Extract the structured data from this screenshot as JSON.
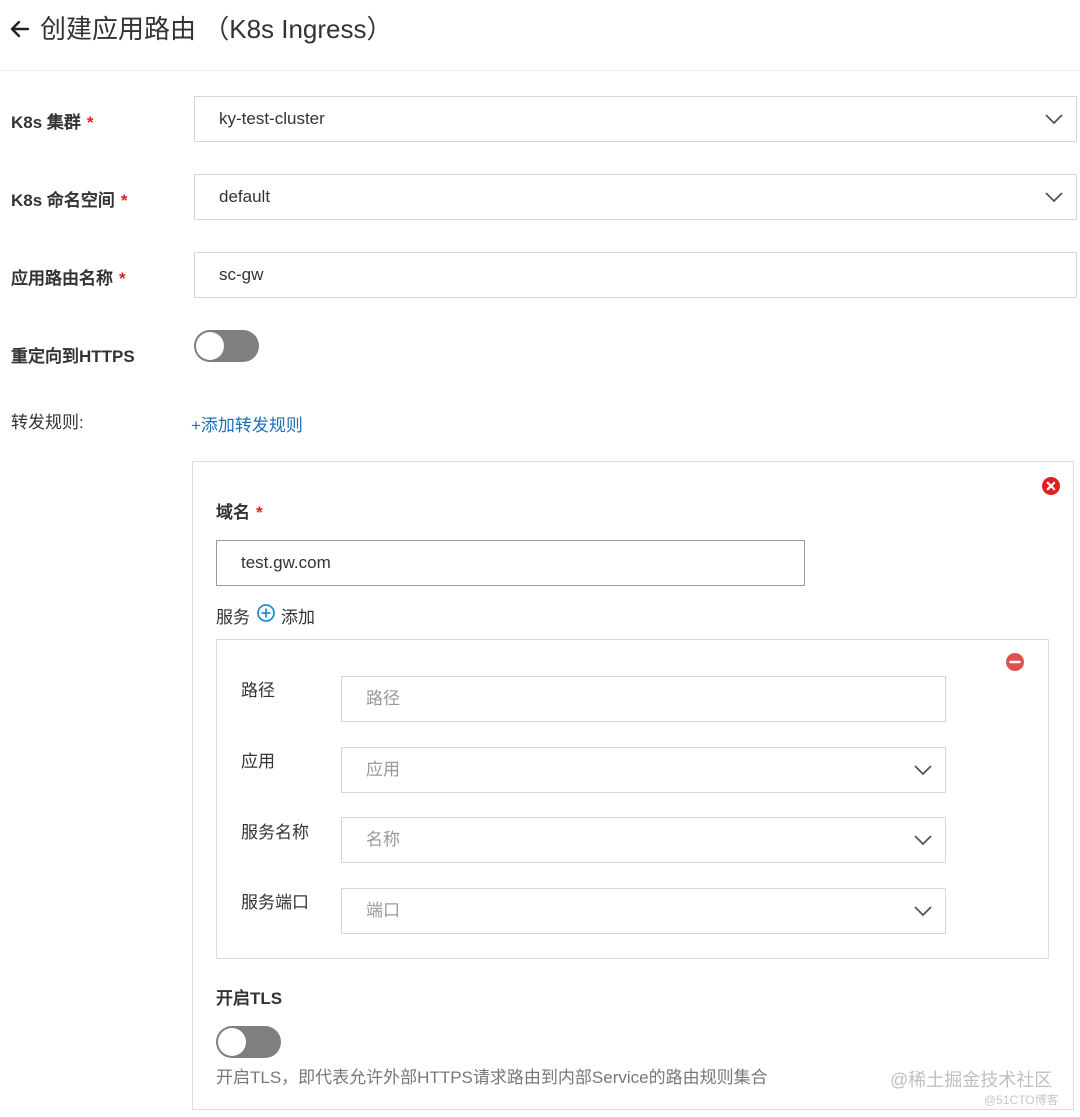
{
  "header": {
    "title": "创建应用路由 （K8s Ingress）",
    "back_icon": "arrow-left-icon"
  },
  "form": {
    "cluster": {
      "label": "K8s 集群",
      "required_mark": "*",
      "value": "ky-test-cluster"
    },
    "namespace": {
      "label": "K8s 命名空间",
      "required_mark": "*",
      "value": "default"
    },
    "route_name": {
      "label": "应用路由名称",
      "required_mark": "*",
      "value": "sc-gw"
    },
    "redirect_https": {
      "label": "重定向到HTTPS",
      "enabled": false
    },
    "forward_rules": {
      "label": "转发规则:",
      "add_link": "+添加转发规则"
    }
  },
  "rule": {
    "domain": {
      "label": "域名",
      "required_mark": "*",
      "value": "test.gw.com"
    },
    "service": {
      "label": "服务",
      "add_label": "添加"
    },
    "service_entry": {
      "path": {
        "label": "路径",
        "placeholder": "路径"
      },
      "app": {
        "label": "应用",
        "placeholder": "应用"
      },
      "service_name": {
        "label": "服务名称",
        "placeholder": "名称"
      },
      "service_port": {
        "label": "服务端口",
        "placeholder": "端口"
      }
    },
    "tls": {
      "label": "开启TLS",
      "enabled": false,
      "hint": "开启TLS，即代表允许外部HTTPS请求路由到内部Service的路由规则集合"
    }
  },
  "watermark": {
    "main": "@稀土掘金技术社区",
    "sub": "@51CTO博客"
  },
  "colors": {
    "required": "#e02020",
    "link": "#1d6fb8",
    "remove": "#e02020",
    "add": "#1d8fd6",
    "toggle_off": "#7f7f7f"
  }
}
